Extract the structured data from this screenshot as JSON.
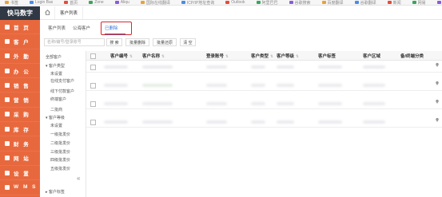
{
  "bookmarks": [
    "书签",
    "Login Bas",
    "首页",
    "Zone",
    "Aliqu",
    "国际在线翻译",
    "ICP/IP地址查询",
    "Outlook",
    "阿里巴巴",
    "谷歌搜索",
    "百度翻译",
    "谷歌翻译",
    "新闻",
    "网易",
    "邮件"
  ],
  "brand": "快马数字",
  "nav": [
    {
      "label": "首 页",
      "icon": "home-icon"
    },
    {
      "label": "客 户",
      "icon": "customer-icon"
    },
    {
      "label": "外 勤",
      "icon": "field-icon"
    },
    {
      "label": "办 公",
      "icon": "office-icon"
    },
    {
      "label": "销 售",
      "icon": "sales-icon"
    },
    {
      "label": "营 销",
      "icon": "marketing-icon"
    },
    {
      "label": "采 购",
      "icon": "purchase-icon"
    },
    {
      "label": "库 存",
      "icon": "inventory-icon"
    },
    {
      "label": "财 务",
      "icon": "finance-icon"
    },
    {
      "label": "网 站",
      "icon": "website-icon"
    },
    {
      "label": "设 置",
      "icon": "settings-icon"
    },
    {
      "label": "W M S",
      "icon": "wms-icon"
    }
  ],
  "topbar": {
    "tab": "客户列表"
  },
  "subtabs": [
    {
      "label": "客户列表",
      "active": false
    },
    {
      "label": "公海客户",
      "active": false
    },
    {
      "label": "已删除",
      "active": true
    }
  ],
  "toolbar": {
    "search_placeholder": "名称/编号/登录账号",
    "search_btn": "搜 索",
    "batch_delete": "批量删除",
    "batch_restore": "批量还原",
    "clear": "清 空"
  },
  "tree": [
    {
      "label": "全部客户",
      "indent": 0,
      "arrow": ""
    },
    {
      "label": "客户类型",
      "indent": 0,
      "arrow": "▾"
    },
    {
      "label": "未设置",
      "indent": 1,
      "arrow": ""
    },
    {
      "label": "在线支付客户",
      "indent": 1,
      "arrow": ""
    },
    {
      "label": "线下付款客户",
      "indent": 1,
      "arrow": ""
    },
    {
      "label": "终端客户",
      "indent": 1,
      "arrow": ""
    },
    {
      "label": "二批商",
      "indent": 1,
      "arrow": ""
    },
    {
      "label": "客户等级",
      "indent": 0,
      "arrow": "▾"
    },
    {
      "label": "未设置",
      "indent": 1,
      "arrow": ""
    },
    {
      "label": "一级批发价",
      "indent": 1,
      "arrow": ""
    },
    {
      "label": "二级批发价",
      "indent": 1,
      "arrow": ""
    },
    {
      "label": "三级批发价",
      "indent": 1,
      "arrow": ""
    },
    {
      "label": "四级批发价",
      "indent": 1,
      "arrow": ""
    },
    {
      "label": "五级批发价",
      "indent": 1,
      "arrow": ""
    },
    {
      "label": "客户标签",
      "indent": 0,
      "arrow": "▸"
    }
  ],
  "table": {
    "columns": [
      "客户编号",
      "客户名称",
      "登录账号",
      "客户类型",
      "客户等级",
      "客户标签",
      "客户区域",
      "备/终端分类"
    ],
    "row_count": 4
  },
  "colors": {
    "sidebar": "#e8683d",
    "brand_bg": "#2f3844",
    "accent": "#3a7bd5",
    "highlight": "#d9262c"
  }
}
